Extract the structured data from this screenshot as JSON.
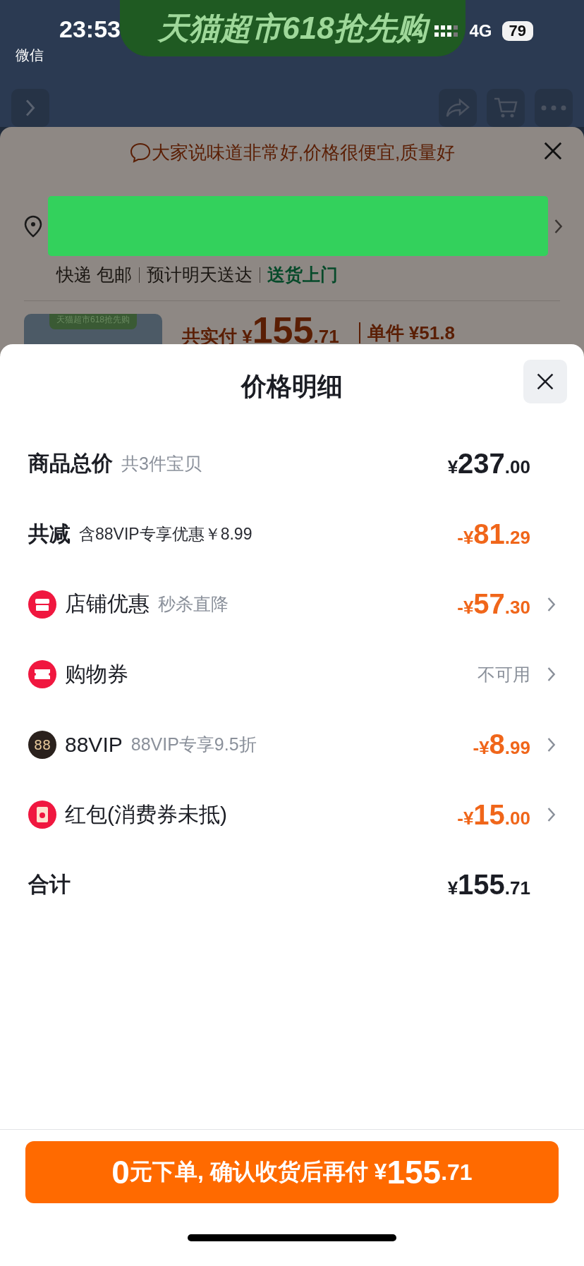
{
  "status_bar": {
    "time": "23:53",
    "back_app": "微信",
    "network": "4G",
    "battery": "79"
  },
  "banner": {
    "title": "天猫超市618抢先购"
  },
  "order_sheet": {
    "hint": "大家说味道非常好,价格很便宜,质量好",
    "delivery": [
      {
        "text": "快递 包邮",
        "highlight": false
      },
      {
        "text": "预计明天送达",
        "highlight": false
      },
      {
        "text": "送货上门",
        "highlight": true
      }
    ],
    "product": {
      "thumb_label": "天猫超市618抢先购",
      "paid_label": "共实付",
      "paid_currency": "¥",
      "paid_main": "155",
      "paid_fraction": ".71",
      "unit_price": "单件 ¥51.8"
    }
  },
  "price_detail": {
    "title": "价格明细",
    "rows": [
      {
        "kind": "summary",
        "label": "商品总价",
        "note": "共3件宝贝",
        "discount": false,
        "prefix": "¥",
        "main": "237",
        "fraction": ".00"
      },
      {
        "kind": "summary",
        "label": "共减",
        "note": "含88VIP专享优惠￥8.99",
        "discount": true,
        "prefix": "-¥",
        "main": "81",
        "fraction": ".29"
      },
      {
        "kind": "store",
        "label": "店铺优惠",
        "note": "秒杀直降",
        "discount": true,
        "prefix": "-¥",
        "main": "57",
        "fraction": ".30"
      },
      {
        "kind": "coupon",
        "label": "购物券",
        "status": "不可用"
      },
      {
        "kind": "vip",
        "icon_text": "88",
        "label": "88VIP",
        "note": "88VIP专享9.5折",
        "discount": true,
        "prefix": "-¥",
        "main": "8",
        "fraction": ".99"
      },
      {
        "kind": "envelope",
        "label": "红包(消费券未抵)",
        "discount": true,
        "prefix": "-¥",
        "main": "15",
        "fraction": ".00"
      },
      {
        "kind": "total",
        "label": "合计",
        "discount": false,
        "prefix": "¥",
        "main": "155",
        "fraction": ".71"
      }
    ]
  },
  "pay_button": {
    "lead": "0",
    "text": "元下单, 确认收货后再付 ",
    "currency": "¥",
    "main": "155",
    "fraction": ".71"
  }
}
